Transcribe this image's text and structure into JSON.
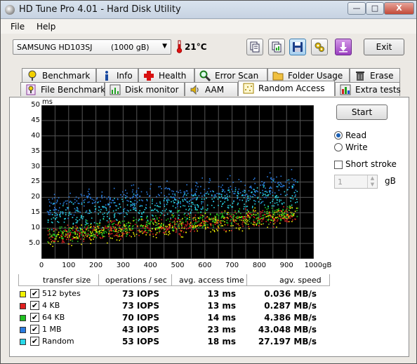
{
  "window": {
    "title": "HD Tune Pro 4.01 - Hard Disk Utility",
    "min": "—",
    "max": "□",
    "close": "X"
  },
  "menu": [
    {
      "label": "File"
    },
    {
      "label": "Help"
    }
  ],
  "toolbar": {
    "drive_name": "SAMSUNG HD103SJ",
    "drive_size": "(1000 gB)",
    "temperature": "21°C",
    "exit_label": "Exit"
  },
  "tabs_row1": [
    {
      "label": "Benchmark"
    },
    {
      "label": "Info"
    },
    {
      "label": "Health"
    },
    {
      "label": "Error Scan"
    },
    {
      "label": "Folder Usage"
    },
    {
      "label": "Erase"
    }
  ],
  "tabs_row2": [
    {
      "label": "File Benchmark"
    },
    {
      "label": "Disk monitor"
    },
    {
      "label": "AAM"
    },
    {
      "label": "Random Access"
    },
    {
      "label": "Extra tests"
    }
  ],
  "controls": {
    "start_label": "Start",
    "read_label": "Read",
    "write_label": "Write",
    "short_stroke_label": "Short stroke",
    "stroke_value": "1",
    "stroke_unit": "gB",
    "mode_selected": "Read",
    "short_stroke_checked": false
  },
  "chart_data": {
    "type": "scatter",
    "ylabel_unit": "ms",
    "y_ticks": [
      "50",
      "45",
      "40",
      "35",
      "30",
      "25",
      "20",
      "15",
      "10",
      "5.0"
    ],
    "x_ticks": [
      "0",
      "100",
      "200",
      "300",
      "400",
      "500",
      "600",
      "700",
      "800",
      "900",
      "1000gB"
    ],
    "xlim": [
      0,
      1000
    ],
    "ylim": [
      0,
      50
    ],
    "grid": true,
    "background": "#000000",
    "grid_color": "#555555",
    "series": [
      {
        "name": "512 bytes",
        "color": "#f2f200",
        "trend_start_ms": 7,
        "trend_end_ms": 15,
        "spread_ms": 3
      },
      {
        "name": "4 KB",
        "color": "#e02020",
        "trend_start_ms": 7,
        "trend_end_ms": 15,
        "spread_ms": 3
      },
      {
        "name": "64 KB",
        "color": "#20c020",
        "trend_start_ms": 8,
        "trend_end_ms": 16,
        "spread_ms": 3
      },
      {
        "name": "1 MB",
        "color": "#2a7ce0",
        "trend_start_ms": 17,
        "trend_end_ms": 25,
        "spread_ms": 4
      },
      {
        "name": "Random",
        "color": "#28d8e8",
        "trend_start_ms": 13,
        "trend_end_ms": 22,
        "spread_ms": 4
      }
    ]
  },
  "table": {
    "headers": [
      "transfer size",
      "operations / sec",
      "avg. access time",
      "agv. speed"
    ],
    "rows": [
      {
        "name": "512 bytes",
        "color": "#f2f200",
        "checked": true,
        "ops": "73 IOPS",
        "access": "13 ms",
        "speed": "0.036 MB/s"
      },
      {
        "name": "4 KB",
        "color": "#e02020",
        "checked": true,
        "ops": "73 IOPS",
        "access": "13 ms",
        "speed": "0.287 MB/s"
      },
      {
        "name": "64 KB",
        "color": "#20c020",
        "checked": true,
        "ops": "70 IOPS",
        "access": "14 ms",
        "speed": "4.386 MB/s"
      },
      {
        "name": "1 MB",
        "color": "#2a7ce0",
        "checked": true,
        "ops": "43 IOPS",
        "access": "23 ms",
        "speed": "43.048 MB/s"
      },
      {
        "name": "Random",
        "color": "#28d8e8",
        "checked": true,
        "ops": "53 IOPS",
        "access": "18 ms",
        "speed": "27.197 MB/s"
      }
    ]
  }
}
